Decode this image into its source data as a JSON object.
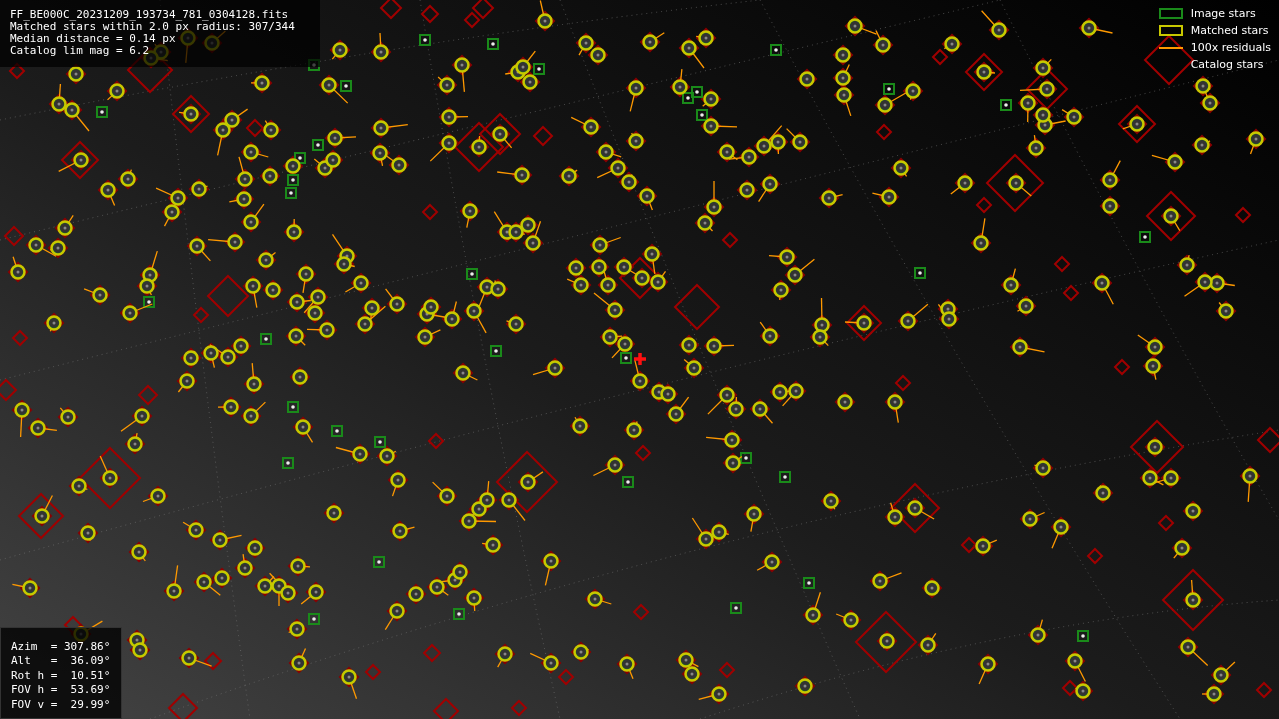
{
  "header": {
    "lines": [
      "FF_BE000C_20231209_193734_781_0304128.fits",
      "Matched stars within 2.0 px radius: 307/344",
      "Median distance = 0.14 px",
      "Catalog lim mag = 6.2"
    ]
  },
  "legend": [
    {
      "label": "Image stars",
      "kind": "box",
      "color": "#1a8a1a"
    },
    {
      "label": "Matched stars",
      "kind": "box",
      "color": "#c8c800"
    },
    {
      "label": "100x residuals",
      "kind": "line",
      "color": "#ff9900"
    },
    {
      "label": "Catalog stars",
      "kind": "none"
    }
  ],
  "pointing": {
    "lines": [
      "Azim  = 307.86°",
      "Alt   =  36.09°",
      "Rot h =  10.51°",
      "FOV h =  53.69°",
      "FOV v =  29.99°"
    ]
  }
}
